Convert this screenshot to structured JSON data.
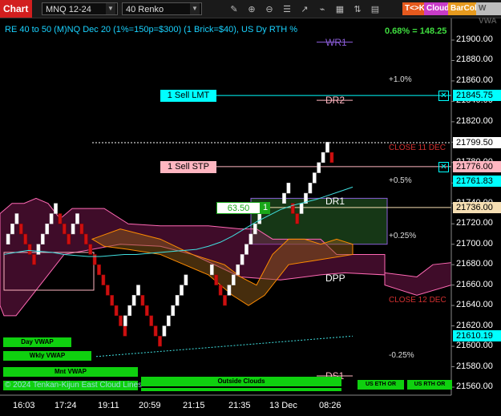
{
  "toolbar": {
    "tab": "Chart",
    "instrument": "MNQ 12-24",
    "bar_type": "40 Renko",
    "tk_btn": "T<>K",
    "cloud_btn": "Cloud",
    "barcol_btn": "BarCol",
    "wvwa_btn": "W VWA",
    "colors": {
      "tk": "#e65a1e",
      "cloud": "#c83cc8",
      "barcol": "#e69a1e",
      "wvwa": "#bdbdbd"
    }
  },
  "header": {
    "title": "RE 40 to 50 (M)NQ Dec 20 (1%=150p=$300) (1 Brick=$40), US Dy RTH %",
    "change": "0.68% = 148.25"
  },
  "y_axis": {
    "ticks": [
      "21900.00",
      "21880.00",
      "21860.00",
      "21840.00",
      "21820.00",
      "21800.00",
      "21780.00",
      "21760.00",
      "21740.00",
      "21720.00",
      "21700.00",
      "21680.00",
      "21660.00",
      "21640.00",
      "21620.00",
      "21600.00",
      "21580.00",
      "21560.00"
    ],
    "price_tags": [
      {
        "value": 21845.75,
        "text": "21845.75",
        "bg": "#00ffff",
        "fg": "#000"
      },
      {
        "value": 21799.5,
        "text": "21799.50",
        "bg": "#ffffff",
        "fg": "#000"
      },
      {
        "value": 21776.0,
        "text": "21776.00",
        "bg": "#ffb6c1",
        "fg": "#000"
      },
      {
        "value": 21761.83,
        "text": "21761.83",
        "bg": "#00ffff",
        "fg": "#000"
      },
      {
        "value": 21736.0,
        "text": "21736.00",
        "bg": "#f5deb3",
        "fg": "#000"
      },
      {
        "value": 21610.19,
        "text": "21610.19",
        "bg": "#00ffff",
        "fg": "#000"
      }
    ]
  },
  "x_axis": {
    "labels": [
      "16:03",
      "17:24",
      "19:11",
      "20:59",
      "21:15",
      "21:35",
      "13 Dec",
      "08:26"
    ]
  },
  "orders": {
    "sell_lmt": {
      "label": "1 Sell LMT",
      "value": 21845.75
    },
    "sell_stp": {
      "label": "1 Sell STP",
      "value": 21776.0
    },
    "position": {
      "pnl": "63.50",
      "qty": "1",
      "value": 21736.0
    }
  },
  "levels": [
    {
      "label": "WR1",
      "value": 21898,
      "color": "#8a5cd6"
    },
    {
      "label": "+1.0%",
      "value": 21860,
      "color": "#dddddd"
    },
    {
      "label": "DR2",
      "value": 21841,
      "color": "#ffb6c1"
    },
    {
      "label": "CLOSE 11 DEC",
      "value": 21793,
      "color": "#d23030"
    },
    {
      "label": "+0.5%",
      "value": 21761,
      "color": "#dddddd"
    },
    {
      "label": "DR1",
      "value": 21742,
      "color": "#ffffff"
    },
    {
      "label": "+0.25%",
      "value": 21707,
      "color": "#dddddd"
    },
    {
      "label": "DPP",
      "value": 21667,
      "color": "#ffffff"
    },
    {
      "label": "CLOSE 12 DEC",
      "value": 21644,
      "color": "#d23030"
    },
    {
      "label": "-0.25%",
      "value": 21590,
      "color": "#dddddd"
    },
    {
      "label": "DS1",
      "value": 21571,
      "color": "#ffb6c1"
    }
  ],
  "bottom_labels": {
    "day_vwap": "Day VWAP",
    "wkly_vwap": "Wkly VWAP",
    "mnt_vwap": "Mnt VWAP",
    "watermark": "© 2024 Tenkan-Kijun East Cloud Lines",
    "outside_clouds": "Outside Clouds",
    "us_eth_or": "US ETH OR",
    "us_rth_or": "US RTH OR"
  },
  "chart_data": {
    "type": "renko",
    "brick_size_points": 10,
    "bricks": [
      {
        "open": 21700,
        "close": 21710
      },
      {
        "open": 21710,
        "close": 21720
      },
      {
        "open": 21720,
        "close": 21730
      },
      {
        "open": 21720,
        "close": 21710
      },
      {
        "open": 21710,
        "close": 21700
      },
      {
        "open": 21700,
        "close": 21690
      },
      {
        "open": 21690,
        "close": 21680
      },
      {
        "open": 21690,
        "close": 21700
      },
      {
        "open": 21700,
        "close": 21710
      },
      {
        "open": 21710,
        "close": 21720
      },
      {
        "open": 21720,
        "close": 21730
      },
      {
        "open": 21730,
        "close": 21740
      },
      {
        "open": 21730,
        "close": 21720
      },
      {
        "open": 21720,
        "close": 21710
      },
      {
        "open": 21710,
        "close": 21700
      },
      {
        "open": 21710,
        "close": 21720
      },
      {
        "open": 21720,
        "close": 21730
      },
      {
        "open": 21720,
        "close": 21710
      },
      {
        "open": 21710,
        "close": 21700
      },
      {
        "open": 21700,
        "close": 21690
      },
      {
        "open": 21690,
        "close": 21680
      },
      {
        "open": 21680,
        "close": 21670
      },
      {
        "open": 21670,
        "close": 21660
      },
      {
        "open": 21660,
        "close": 21650
      },
      {
        "open": 21650,
        "close": 21640
      },
      {
        "open": 21640,
        "close": 21630
      },
      {
        "open": 21630,
        "close": 21620
      },
      {
        "open": 21620,
        "close": 21610
      },
      {
        "open": 21620,
        "close": 21630
      },
      {
        "open": 21630,
        "close": 21640
      },
      {
        "open": 21640,
        "close": 21650
      },
      {
        "open": 21650,
        "close": 21660
      },
      {
        "open": 21650,
        "close": 21640
      },
      {
        "open": 21640,
        "close": 21630
      },
      {
        "open": 21630,
        "close": 21620
      },
      {
        "open": 21620,
        "close": 21610
      },
      {
        "open": 21610,
        "close": 21600
      },
      {
        "open": 21610,
        "close": 21620
      },
      {
        "open": 21620,
        "close": 21630
      },
      {
        "open": 21630,
        "close": 21640
      },
      {
        "open": 21640,
        "close": 21650
      },
      {
        "open": 21650,
        "close": 21660
      },
      {
        "open": 21660,
        "close": 21670
      },
      {
        "open": 21670,
        "close": 21680
      },
      {
        "open": 21670,
        "close": 21660
      },
      {
        "open": 21660,
        "close": 21650
      },
      {
        "open": 21650,
        "close": 21640
      },
      {
        "open": 21650,
        "close": 21660
      },
      {
        "open": 21660,
        "close": 21670
      },
      {
        "open": 21670,
        "close": 21680
      },
      {
        "open": 21680,
        "close": 21690
      },
      {
        "open": 21690,
        "close": 21700
      },
      {
        "open": 21700,
        "close": 21710
      },
      {
        "open": 21710,
        "close": 21720
      },
      {
        "open": 21720,
        "close": 21730
      },
      {
        "open": 21730,
        "close": 21740
      },
      {
        "open": 21740,
        "close": 21750
      },
      {
        "open": 21750,
        "close": 21760
      },
      {
        "open": 21740,
        "close": 21730
      },
      {
        "open": 21730,
        "close": 21720
      },
      {
        "open": 21730,
        "close": 21740
      },
      {
        "open": 21740,
        "close": 21750
      },
      {
        "open": 21750,
        "close": 21760
      },
      {
        "open": 21760,
        "close": 21770
      },
      {
        "open": 21770,
        "close": 21780
      },
      {
        "open": 21780,
        "close": 21790
      },
      {
        "open": 21790,
        "close": 21800
      },
      {
        "open": 21790,
        "close": 21780
      }
    ],
    "vwap_day": [
      21690,
      21692,
      21694,
      21693,
      21692,
      21690,
      21689,
      21688,
      21688,
      21689,
      21690,
      21690,
      21691,
      21692,
      21693,
      21694,
      21695,
      21698,
      21702,
      21708,
      21715,
      21722,
      21728,
      21734,
      21738,
      21741,
      21744,
      21748,
      21752,
      21756
    ],
    "vwap_week": [
      21590,
      21591,
      21592,
      21593,
      21594,
      21595,
      21596,
      21597,
      21598,
      21599,
      21600,
      21601,
      21602,
      21603,
      21604,
      21605,
      21606,
      21607,
      21608,
      21609,
      21610
    ],
    "colors": {
      "up": "#ffffff",
      "down": "#cc1010",
      "vwap": "#40e0e0",
      "cloud_pink": "#ff69b4",
      "cloud_orange": "#ff8c00"
    }
  }
}
